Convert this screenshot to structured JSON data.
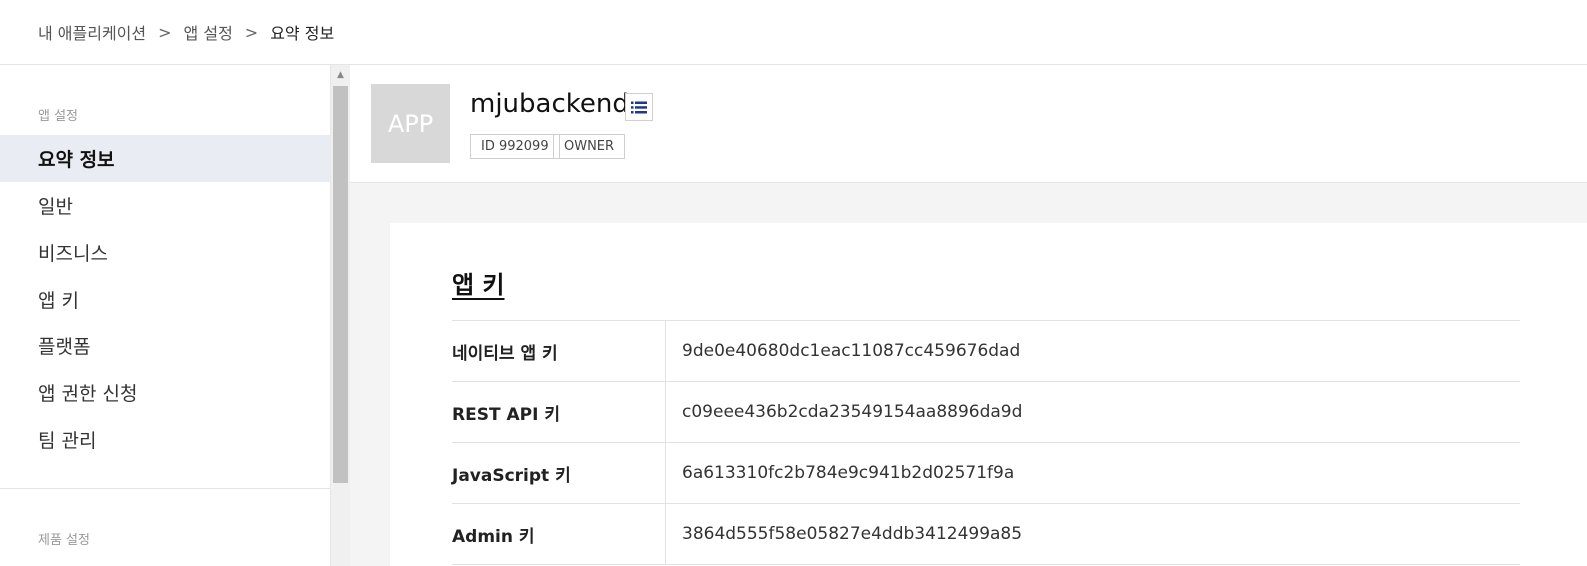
{
  "breadcrumb": {
    "items": [
      "내 애플리케이션",
      "앱 설정",
      "요약 정보"
    ],
    "separator": ">"
  },
  "sidebar": {
    "section_title": "앱 설정",
    "items": [
      {
        "label": "요약 정보",
        "active": true
      },
      {
        "label": "일반"
      },
      {
        "label": "비즈니스"
      },
      {
        "label": "앱 키"
      },
      {
        "label": "플랫폼"
      },
      {
        "label": "앱 권한 신청"
      },
      {
        "label": "팀 관리"
      }
    ],
    "section2_title": "제품 설정"
  },
  "app": {
    "icon_text": "APP",
    "name": "mjubackend",
    "id_tag": "ID 992099",
    "role_tag": "OWNER",
    "menu_icon": "list-icon"
  },
  "app_keys": {
    "title": "앱 키",
    "rows": [
      {
        "label": "네이티브 앱 키",
        "value": "9de0e40680dc1eac11087cc459676dad"
      },
      {
        "label": "REST API 키",
        "value": "c09eee436b2cda23549154aa8896da9d"
      },
      {
        "label": "JavaScript 키",
        "value": "6a613310fc2b784e9c941b2d02571f9a"
      },
      {
        "label": "Admin 키",
        "value": "3864d555f58e05827e4ddb3412499a85"
      }
    ]
  },
  "colors": {
    "active_bg": "#e9ecf3",
    "icon_blue": "#1f3a8a",
    "app_icon_bg": "#d8d8d8"
  }
}
